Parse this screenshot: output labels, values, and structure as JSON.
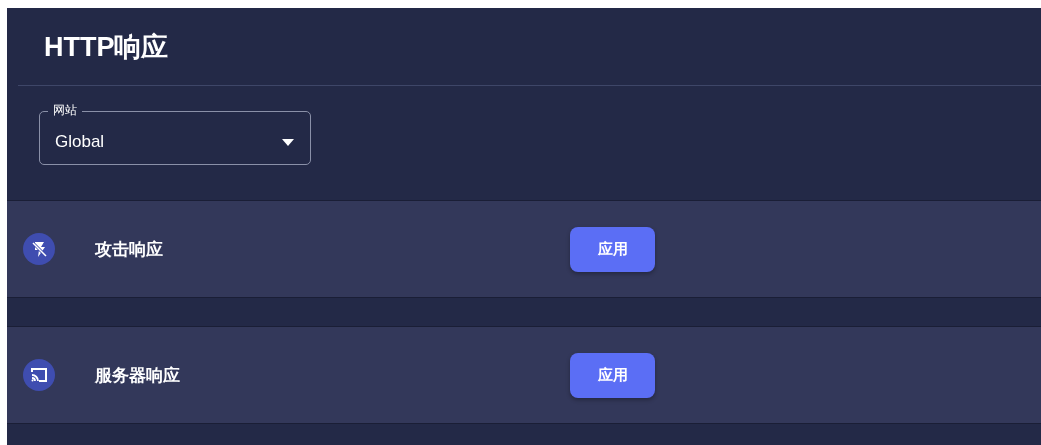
{
  "page": {
    "title": "HTTP响应"
  },
  "site_select": {
    "label": "网站",
    "value": "Global"
  },
  "rows": [
    {
      "kind": "flash-off",
      "label": "攻击响应",
      "button": "应用"
    },
    {
      "kind": "cast",
      "label": "服务器响应",
      "button": "应用"
    }
  ]
}
